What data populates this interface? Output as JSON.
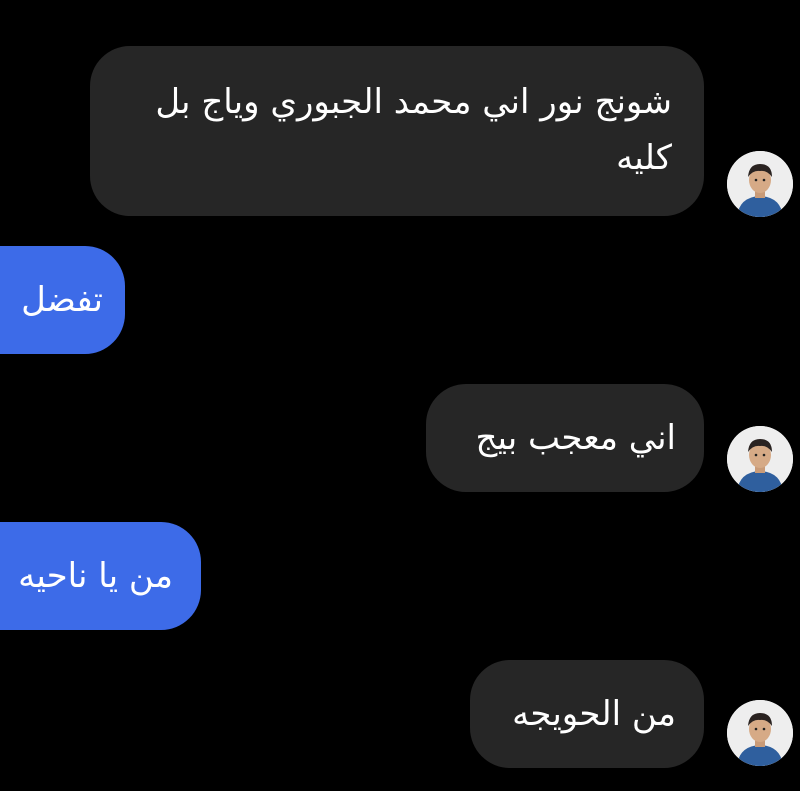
{
  "conversation": {
    "messages": [
      {
        "lines": [
          "شونج نور اني محمد الجبوري وياج بل",
          "كليه"
        ]
      },
      {
        "text": "تفضل"
      },
      {
        "text": "اني معجب بيج"
      },
      {
        "text": "من يا ناحيه"
      },
      {
        "text": "من الحويجه"
      }
    ]
  },
  "colors": {
    "background": "#000000",
    "received_bubble": "#262626",
    "sent_bubble": "#3d6be8",
    "text": "#ffffff"
  },
  "icons": {
    "avatar": "user-avatar-photo"
  }
}
